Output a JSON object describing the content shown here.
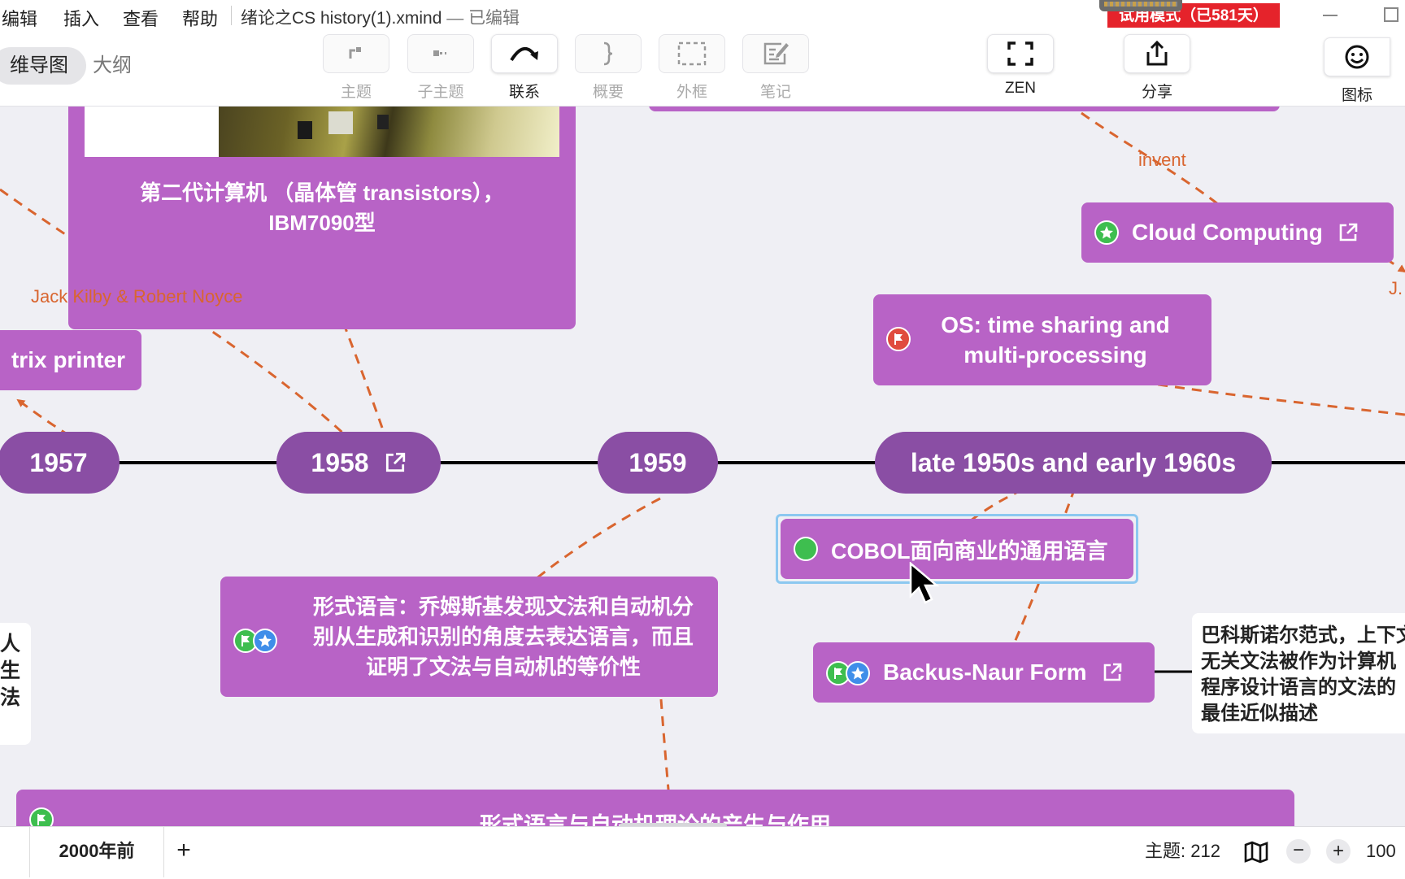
{
  "menubar": {
    "items": [
      "编辑",
      "插入",
      "查看",
      "帮助"
    ],
    "doc_title": "绪论之CS history(1).xmind",
    "doc_sep": " — ",
    "doc_state": "已编辑",
    "trial_badge": "试用模式（已581天）"
  },
  "toolbar": {
    "view_tabs": {
      "mindmap": "维导图",
      "outline": "大纲"
    },
    "tools": [
      {
        "label": "主题",
        "icon": "topic-icon",
        "enabled": false
      },
      {
        "label": "子主题",
        "icon": "subtopic-icon",
        "enabled": false
      },
      {
        "label": "联系",
        "icon": "relationship-icon",
        "enabled": true
      },
      {
        "label": "概要",
        "icon": "summary-brace-icon",
        "enabled": false
      },
      {
        "label": "外框",
        "icon": "boundary-icon",
        "enabled": false
      },
      {
        "label": "笔记",
        "icon": "note-icon",
        "enabled": false
      }
    ],
    "zen_label": "ZEN",
    "share_label": "分享",
    "icon_panel_label": "图标"
  },
  "canvas": {
    "years": [
      "1957",
      "1958",
      "1959",
      "late 1950s and early 1960s"
    ],
    "topics": {
      "second_gen_line1": "第二代计算机 （晶体管 transistors），",
      "second_gen_line2": "IBM7090型",
      "printer": "trix printer",
      "cloud": "Cloud Computing",
      "os_line1": "OS: time sharing and",
      "os_line2": "multi-processing",
      "cobol": "COBOL面向商业的通用语言",
      "formal_line1": "形式语言：乔姆斯基发现文法和自动机分",
      "formal_line2": "别从生成和识别的角度去表达语言，而且",
      "formal_line3": "证明了文法与自动机的等价性",
      "bnf": "Backus-Naur Form",
      "bottom": "形式语言与自动机理论的产生与作用"
    },
    "relationship_labels": {
      "invent": "invent",
      "kilby": "Jack Kilby & Robert Noyce",
      "partial": "J."
    },
    "notes": {
      "bnf_note": [
        "巴科斯诺尔范式，上下文",
        "无关文法被作为计算机",
        "程序设计语言的文法的",
        "最佳近似描述"
      ],
      "left_note": [
        "人",
        "生",
        "法"
      ]
    },
    "colors": {
      "topic": "#b863c6",
      "year": "#8a4ea4",
      "relationship": "#d9652f",
      "selection": "#8cc8f0"
    }
  },
  "statusbar": {
    "sheet_name": "2000年前",
    "add_sheet": "+",
    "topic_count": "主题: 212",
    "zoom_out": "−",
    "zoom_in": "+",
    "zoom": "100"
  }
}
